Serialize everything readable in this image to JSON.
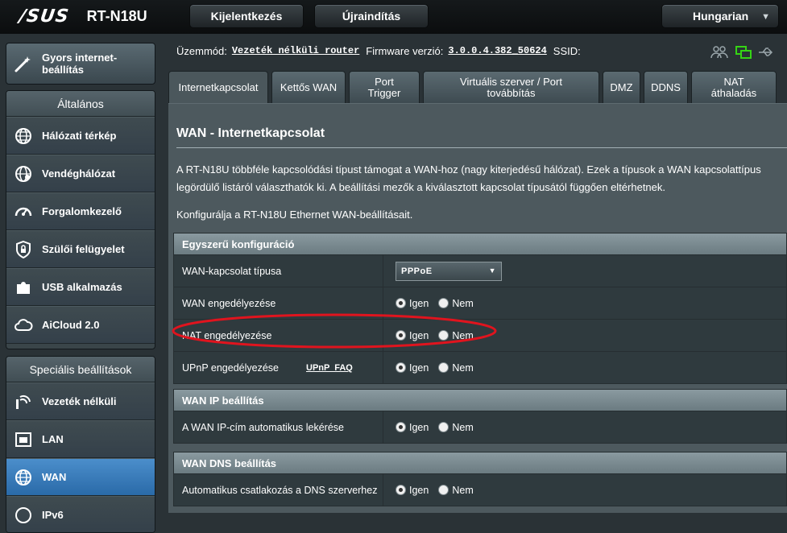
{
  "header": {
    "brand": "/SUS",
    "model": "RT-N18U",
    "logout_label": "Kijelentkezés",
    "reboot_label": "Újraindítás",
    "language": "Hungarian"
  },
  "sidebar": {
    "quick_setup": "Gyors internet-beállítás",
    "general_title": "Általános",
    "general_items": [
      {
        "label": "Hálózati térkép",
        "icon": "globe-network-icon"
      },
      {
        "label": "Vendéghálózat",
        "icon": "globe-users-icon"
      },
      {
        "label": "Forgalomkezelő",
        "icon": "speedometer-icon"
      },
      {
        "label": "Szülői felügyelet",
        "icon": "parental-lock-icon"
      },
      {
        "label": "USB alkalmazás",
        "icon": "puzzle-icon"
      },
      {
        "label": "AiCloud 2.0",
        "icon": "cloud-icon"
      }
    ],
    "advanced_title": "Speciális beállítások",
    "advanced_items": [
      {
        "label": "Vezeték nélküli",
        "icon": "wifi-icon"
      },
      {
        "label": "LAN",
        "icon": "lan-icon"
      },
      {
        "label": "WAN",
        "icon": "globe-icon",
        "active": true
      },
      {
        "label": "IPv6",
        "icon": "ipv6-icon"
      }
    ]
  },
  "status": {
    "mode_label": "Üzemmód:",
    "mode_value": "Vezeték nélküli router",
    "firmware_label": "Firmware verzió:",
    "firmware_value": "3.0.0.4.382_50624",
    "ssid_label": "SSID:"
  },
  "tabs": [
    {
      "label": "Internetkapcsolat",
      "active": true
    },
    {
      "label": "Kettős WAN"
    },
    {
      "label": "Port Trigger"
    },
    {
      "label": "Virtuális szerver / Port továbbítás"
    },
    {
      "label": "DMZ"
    },
    {
      "label": "DDNS"
    },
    {
      "label": "NAT áthaladás"
    }
  ],
  "content": {
    "title": "WAN - Internetkapcsolat",
    "description": "A RT-N18U többféle kapcsolódási típust támogat a WAN-hoz (nagy kiterjedésű hálózat). Ezek a típusok a WAN kapcsolattípus legördülő listáról választhatók ki. A beállítási mezők a kiválasztott kapcsolat típusától függően eltérhetnek.",
    "subdescription": "Konfigurálja a RT-N18U Ethernet WAN-beállításait."
  },
  "basic_config": {
    "title": "Egyszerű konfiguráció",
    "wan_type_label": "WAN-kapcsolat típusa",
    "wan_type_value": "PPPoE",
    "enable_wan_label": "WAN engedélyezése",
    "enable_nat_label": "NAT engedélyezése",
    "enable_upnp_label": "UPnP engedélyezése",
    "upnp_faq": "UPnP  FAQ"
  },
  "wan_ip": {
    "title": "WAN IP beállítás",
    "auto_ip_label": "A WAN IP-cím automatikus lekérése"
  },
  "wan_dns": {
    "title": "WAN DNS beállítás",
    "auto_dns_label": "Automatikus csatlakozás a DNS szerverhez"
  },
  "options": {
    "yes": "Igen",
    "no": "Nem"
  },
  "radio_state": {
    "enable_wan": "yes",
    "enable_nat": "yes",
    "enable_upnp": "yes",
    "auto_ip": "yes",
    "auto_dns": "yes"
  },
  "colors": {
    "annotation": "#e0141e",
    "active_menu": "#3a7cbb",
    "status_green": "#35d415"
  }
}
